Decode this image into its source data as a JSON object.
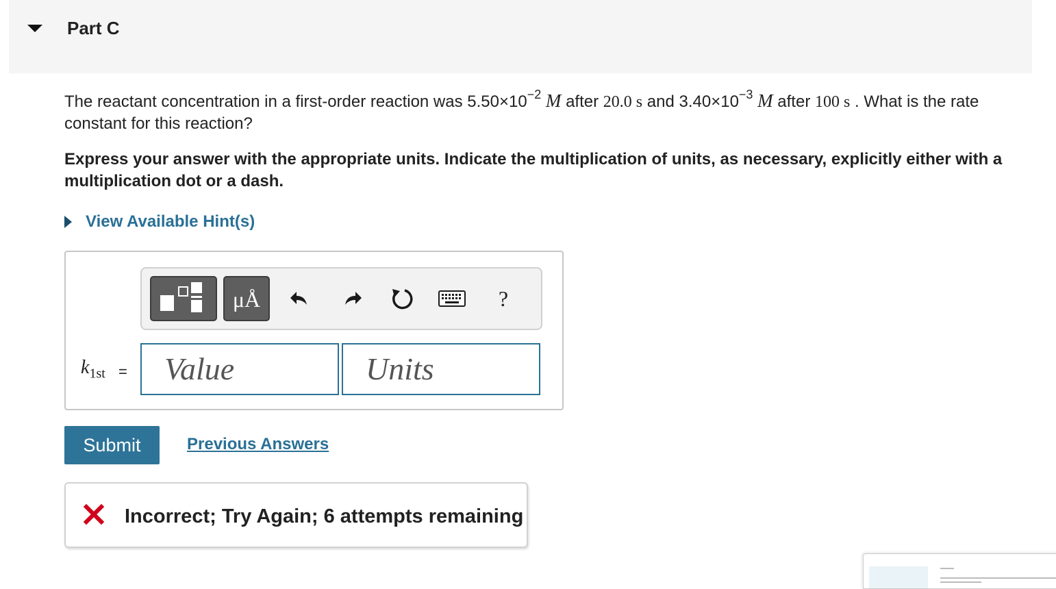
{
  "part": {
    "title": "Part C"
  },
  "question": {
    "text_1": "The reactant concentration in a first-order reaction was 5.50×10",
    "exp_1": "−2",
    "unit_1": "M",
    "text_2": " after ",
    "time_1": "20.0 s",
    "text_3": " and 3.40×10",
    "exp_2": "−3",
    "unit_2": "M",
    "text_4": " after ",
    "time_2": "100 s",
    "text_5": " . What is the rate constant for this reaction?"
  },
  "instruction": "Express your answer with the appropriate units. Indicate the multiplication of units, as necessary, explicitly either with a multiplication dot or a dash.",
  "hints": {
    "label": "View Available Hint(s)"
  },
  "toolbar": {
    "units_button": "μÅ",
    "help": "?"
  },
  "answer": {
    "variable": "k",
    "variable_sub": "1st",
    "equals": "=",
    "value_placeholder": "Value",
    "units_placeholder": "Units"
  },
  "actions": {
    "submit": "Submit",
    "previous_answers": "Previous Answers"
  },
  "feedback": {
    "text": "Incorrect; Try Again; 6 attempts remaining",
    "color": "#d0021b"
  },
  "colors": {
    "accent": "#2a7096",
    "button": "#2e7498"
  }
}
